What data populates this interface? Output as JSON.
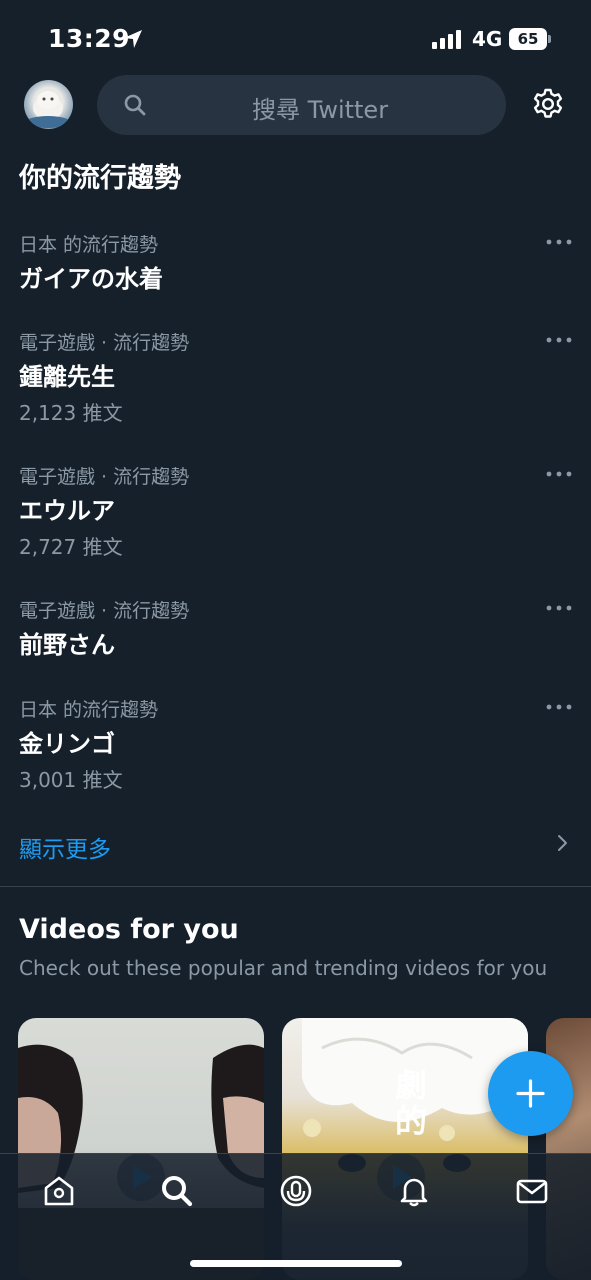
{
  "status_bar": {
    "time": "13:29",
    "network": "4G",
    "battery": "65"
  },
  "search": {
    "placeholder": "搜尋 Twitter"
  },
  "trends": {
    "title": "你的流行趨勢",
    "items": [
      {
        "context": "日本 的流行趨勢",
        "name": "ガイアの水着",
        "count": ""
      },
      {
        "context": " 電子遊戲 · 流行趨勢",
        "name": "鍾離先生",
        "count": "2,123 推文"
      },
      {
        "context": " 電子遊戲 · 流行趨勢",
        "name": "エウルア",
        "count": "2,727 推文"
      },
      {
        "context": " 電子遊戲 · 流行趨勢",
        "name": "前野さん",
        "count": ""
      },
      {
        "context": "日本 的流行趨勢",
        "name": "金リンゴ",
        "count": "3,001 推文"
      }
    ],
    "show_more": "顯示更多"
  },
  "videos": {
    "title": "Videos for you",
    "subtitle": "Check out these popular and trending videos for you",
    "cards": [
      {
        "overlay_text": ""
      },
      {
        "overlay_text": "劇的"
      },
      {
        "overlay_text": ""
      }
    ]
  },
  "colors": {
    "background": "#15202b",
    "accent": "#1d9bf0",
    "secondary_text": "#8b98a5",
    "search_bg": "#273340"
  },
  "icons": {
    "header": [
      "avatar",
      "search-icon",
      "gear-icon"
    ],
    "tab_bar": [
      "home-icon",
      "search-icon",
      "spaces-icon",
      "bell-icon",
      "mail-icon"
    ],
    "fab": "plus-icon"
  }
}
